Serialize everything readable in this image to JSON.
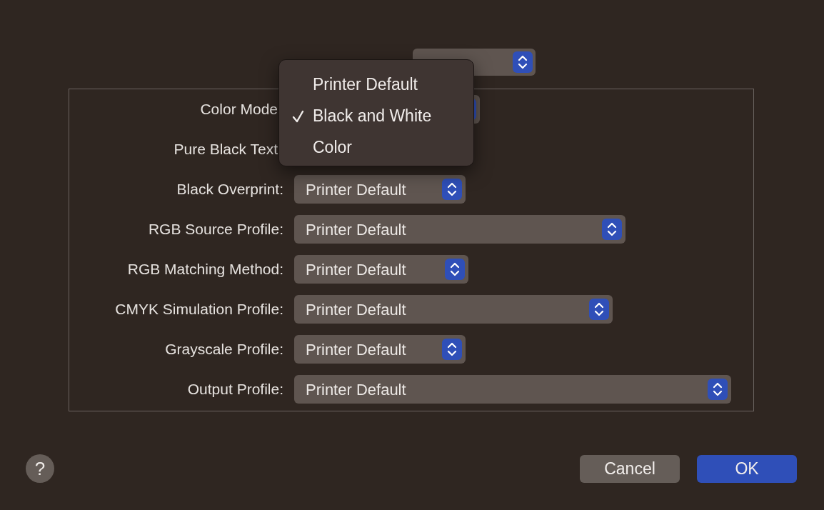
{
  "rows": [
    {
      "label": "Color Mode",
      "kind": "covered"
    },
    {
      "label": "Pure Black Text",
      "kind": "hidden"
    },
    {
      "label": "Black Overprint:",
      "kind": "popup",
      "value": "Printer Default"
    },
    {
      "label": "RGB Source Profile:",
      "kind": "popup",
      "value": "Printer Default"
    },
    {
      "label": "RGB Matching Method:",
      "kind": "popup",
      "value": "Printer Default"
    },
    {
      "label": "CMYK Simulation Profile:",
      "kind": "popup",
      "value": "Printer Default"
    },
    {
      "label": "Grayscale Profile:",
      "kind": "popup",
      "value": "Printer Default"
    },
    {
      "label": "Output Profile:",
      "kind": "popup",
      "value": "Printer Default"
    }
  ],
  "menu": [
    {
      "label": "Printer Default",
      "checked": false
    },
    {
      "label": "Black and White",
      "checked": true
    },
    {
      "label": "Color",
      "checked": false
    }
  ],
  "help": "?",
  "buttons": [
    {
      "label": "Cancel",
      "kind": "secondary"
    },
    {
      "label": "OK",
      "kind": "primary"
    }
  ]
}
